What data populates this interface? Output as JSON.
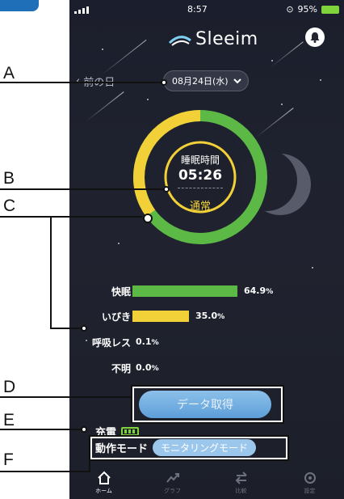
{
  "status_bar": {
    "time": "8:57",
    "battery": "95%"
  },
  "app": {
    "logo_text": "Sleeim"
  },
  "date_nav": {
    "prev_label": "前の日",
    "selected_date": "08月24日(水)"
  },
  "summary": {
    "label": "睡眠時間",
    "duration": "05:26",
    "status": "通常"
  },
  "colors": {
    "comfort": "#5cb946",
    "snore": "#f2d138",
    "button": "#6aa9de",
    "background": "#1d202b"
  },
  "breakdown": [
    {
      "label": "快眠",
      "percent": 64.9,
      "text": "64.9",
      "unit": "%"
    },
    {
      "label": "いびき",
      "percent": 35.0,
      "text": "35.0",
      "unit": "%"
    },
    {
      "label": "呼吸レス",
      "percent": 0.1,
      "text": "0.1",
      "unit": "%"
    },
    {
      "label": "不明",
      "percent": 0.0,
      "text": "0.0",
      "unit": "%"
    }
  ],
  "actions": {
    "get_data_label": "データ取得"
  },
  "device": {
    "charge_label": "充電",
    "mode_label": "動作モード",
    "mode_value": "モニタリングモード"
  },
  "nav": [
    {
      "label": "ホーム",
      "icon": "home-icon"
    },
    {
      "label": "グラフ",
      "icon": "graph-icon"
    },
    {
      "label": "比較",
      "icon": "compare-icon"
    },
    {
      "label": "設定",
      "icon": "settings-icon"
    }
  ],
  "callouts": {
    "a": "A",
    "b": "B",
    "c": "C",
    "d": "D",
    "e": "E",
    "f": "F"
  }
}
